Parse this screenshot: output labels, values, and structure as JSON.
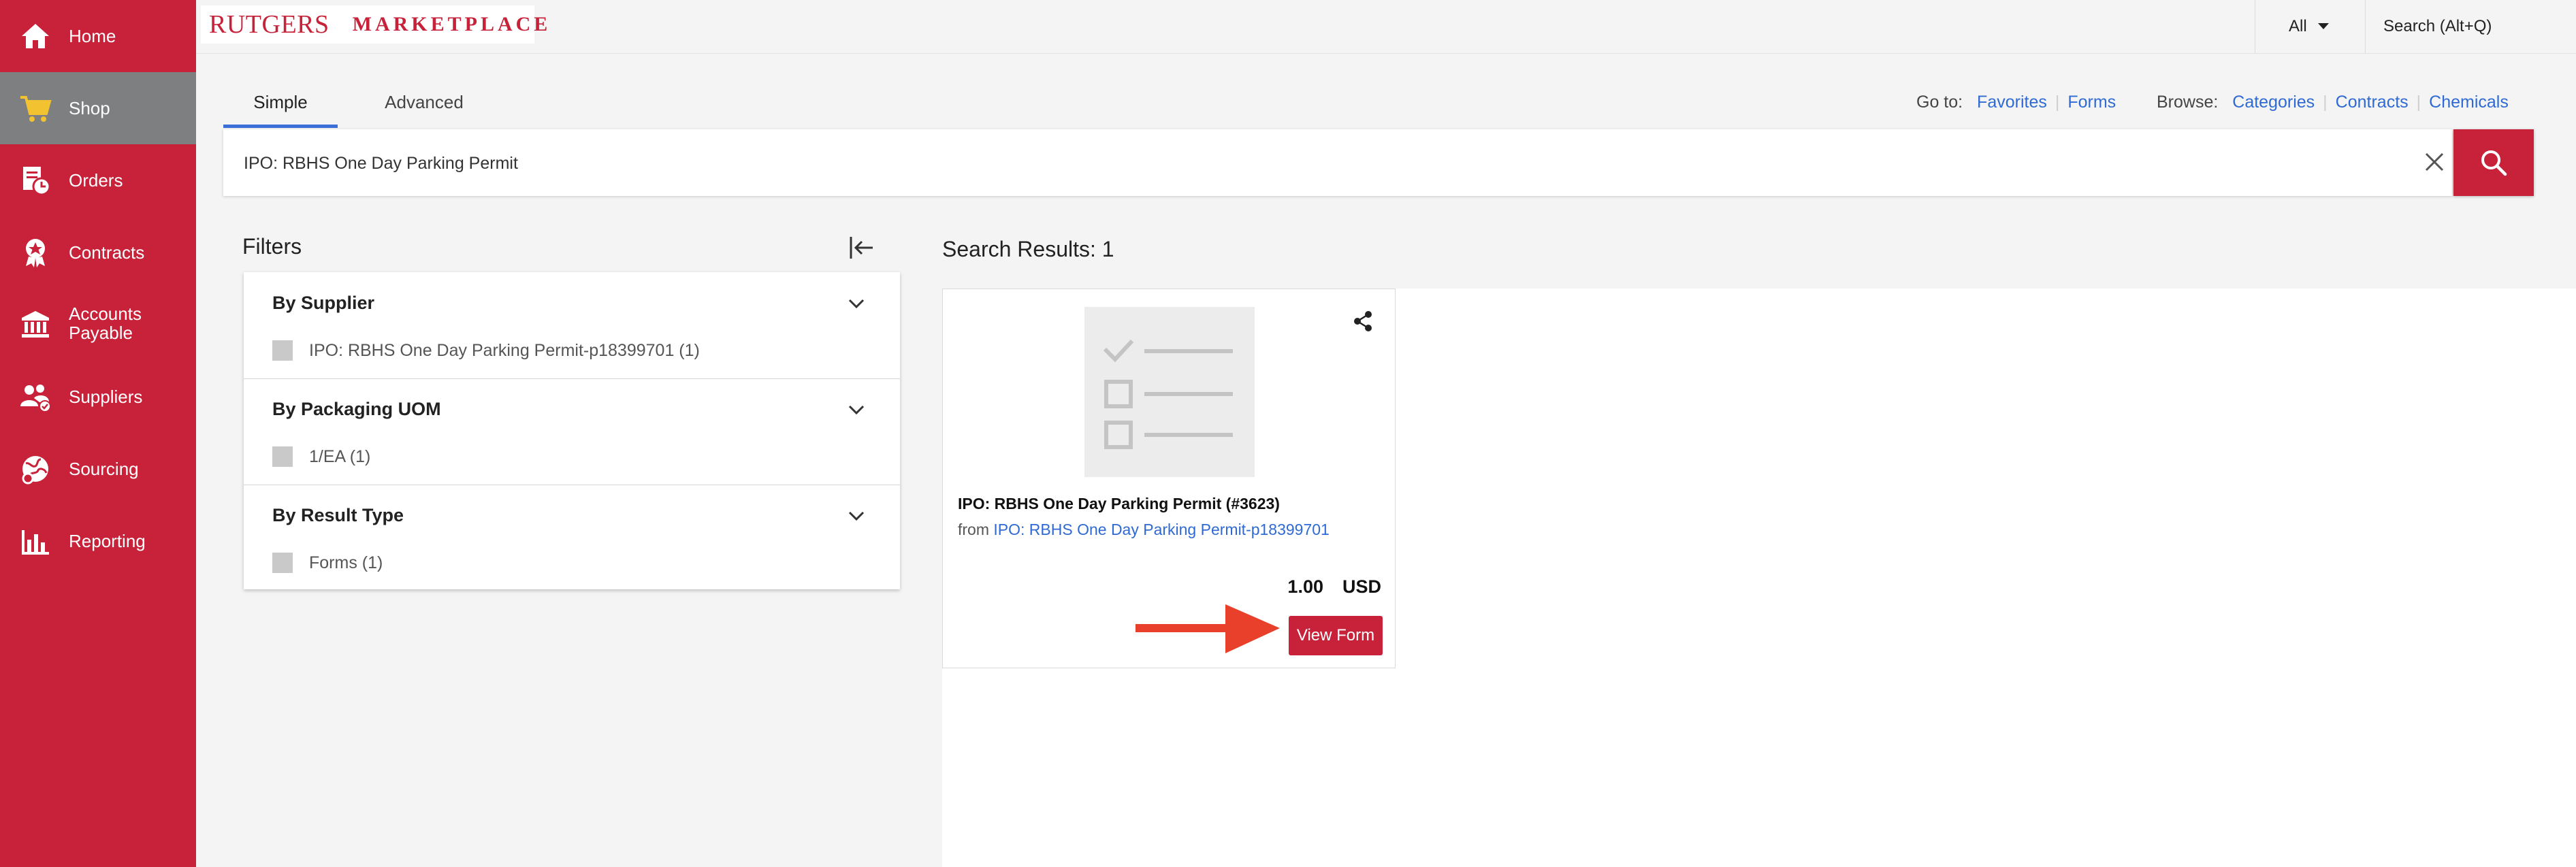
{
  "sidebar": {
    "items": [
      {
        "label": "Home",
        "icon": "home-icon"
      },
      {
        "label": "Shop",
        "icon": "cart-icon",
        "active": true
      },
      {
        "label": "Orders",
        "icon": "orders-icon"
      },
      {
        "label": "Contracts",
        "icon": "contracts-icon"
      },
      {
        "label": "Accounts Payable",
        "label_line1": "Accounts",
        "label_line2": "Payable",
        "icon": "bank-icon"
      },
      {
        "label": "Suppliers",
        "icon": "suppliers-icon"
      },
      {
        "label": "Sourcing",
        "icon": "sourcing-icon"
      },
      {
        "label": "Reporting",
        "icon": "reporting-icon"
      }
    ],
    "color": "#c8223a",
    "active_color": "#7e7f81"
  },
  "header": {
    "logo_text": "RUTGERS",
    "logo_subtext": "MARKETPLACE",
    "scope": "All",
    "quick_search": "Search (Alt+Q)"
  },
  "search": {
    "tabs": [
      "Simple",
      "Advanced"
    ],
    "active_tab": "Simple",
    "goto_label": "Go to:",
    "goto_links": [
      "Favorites",
      "Forms"
    ],
    "browse_label": "Browse:",
    "browse_links": [
      "Categories",
      "Contracts",
      "Chemicals"
    ],
    "query": "IPO: RBHS One Day Parking Permit"
  },
  "filters": {
    "title": "Filters",
    "groups": [
      {
        "title": "By Supplier",
        "option": "IPO: RBHS One Day Parking Permit-p18399701 (1)"
      },
      {
        "title": "By Packaging UOM",
        "option": "1/EA (1)"
      },
      {
        "title": "By Result Type",
        "option": "Forms (1)"
      }
    ]
  },
  "results": {
    "title": "Search Results: 1",
    "items": [
      {
        "name": "IPO: RBHS One Day Parking Permit (#3623)",
        "from_label": "from",
        "supplier": "IPO: RBHS One Day Parking Permit-p18399701",
        "price": "1.00",
        "currency": "USD",
        "action": "View Form"
      }
    ]
  },
  "colors": {
    "brand": "#c8223a",
    "link": "#2f6ad4",
    "annotation_arrow": "#e8402a"
  }
}
